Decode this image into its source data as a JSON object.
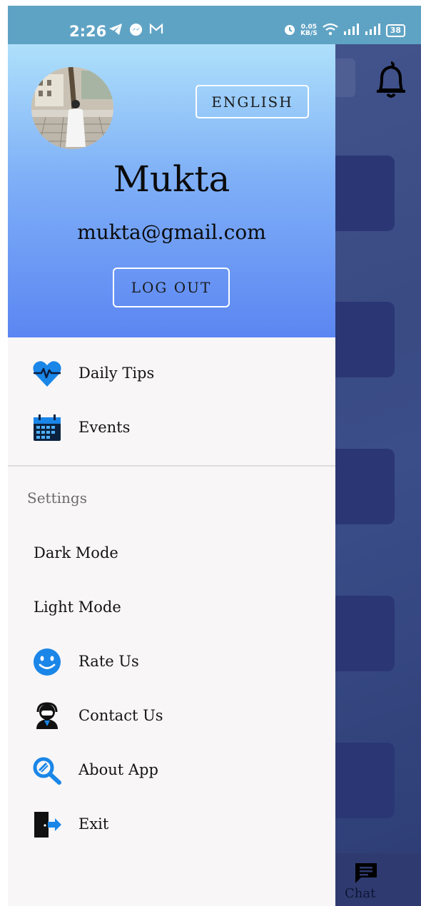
{
  "status_bar": {
    "time": "2:26",
    "left_icons": [
      "telegram-icon",
      "messenger-icon",
      "gmail-icon"
    ],
    "net_speed_value": "0.05",
    "net_speed_unit": "KB/S",
    "battery": "38",
    "right_icons": [
      "alarm-icon",
      "wifi-icon",
      "signal-icon",
      "signal-icon"
    ]
  },
  "drawer": {
    "language_button": "ENGLISH",
    "user_name": "Mukta",
    "user_email": "mukta@gmail.com",
    "logout_button": "LOG OUT",
    "primary_items": [
      {
        "label": "Daily Tips",
        "icon": "heart-pulse-icon"
      },
      {
        "label": "Events",
        "icon": "calendar-icon"
      }
    ],
    "settings_title": "Settings",
    "settings_items": [
      {
        "label": "Dark Mode"
      },
      {
        "label": "Light Mode"
      },
      {
        "label": "Rate Us",
        "icon": "smiley-icon"
      },
      {
        "label": "Contact Us",
        "icon": "support-agent-icon"
      },
      {
        "label": "About App",
        "icon": "magnifier-icon"
      },
      {
        "label": "Exit",
        "icon": "exit-door-icon"
      }
    ]
  },
  "background_app": {
    "bottom_nav": {
      "chat_label": "Chat",
      "icon": "chat-icon"
    },
    "notification_icon": "bell-icon"
  },
  "colors": {
    "status_bar": "#5fa3c4",
    "header_top": "#aee0fb",
    "header_bottom": "#5b86f2",
    "drawer_bg": "#f8f6f7",
    "icon_blue": "#1a86e8",
    "background_overlay": "#3a4a83"
  }
}
